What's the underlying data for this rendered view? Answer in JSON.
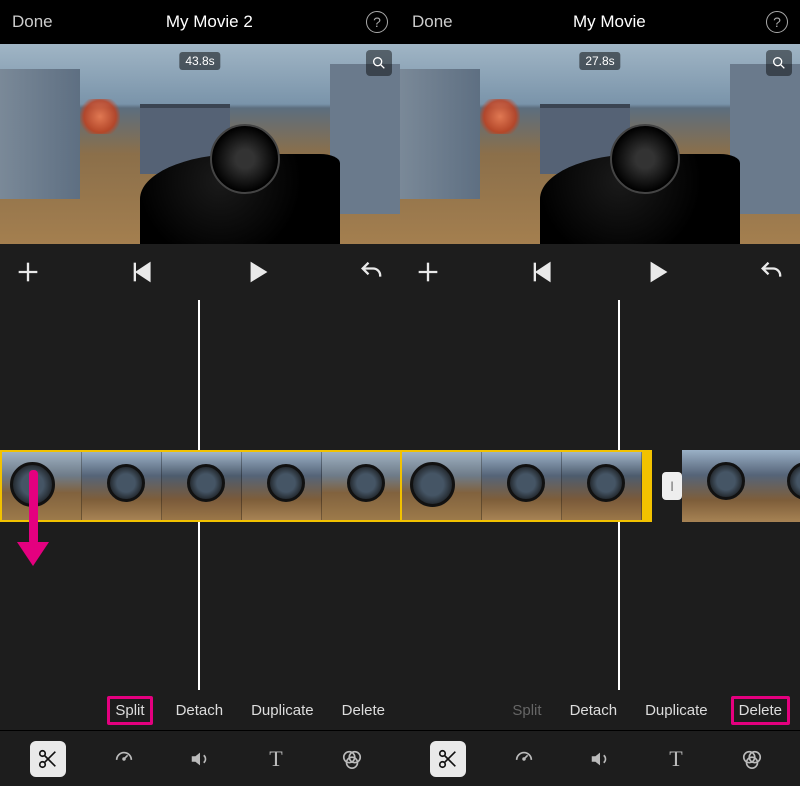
{
  "panels": [
    {
      "header": {
        "done": "Done",
        "title": "My Movie 2",
        "help": "?"
      },
      "preview": {
        "time": "43.8s"
      },
      "playheadLeft": 198,
      "clip": {
        "left": 0,
        "thumbs": 5,
        "hasHandle": false,
        "hasGap": false
      },
      "actions": [
        {
          "label": "Split",
          "boxed": true,
          "dim": false
        },
        {
          "label": "Detach",
          "boxed": false,
          "dim": false
        },
        {
          "label": "Duplicate",
          "boxed": false,
          "dim": false
        },
        {
          "label": "Delete",
          "boxed": false,
          "dim": false
        }
      ],
      "actionsAlign": "left",
      "showArrow": true,
      "toolbarActive": "scissors"
    },
    {
      "header": {
        "done": "Done",
        "title": "My Movie",
        "help": "?"
      },
      "preview": {
        "time": "27.8s"
      },
      "playheadLeft": 218,
      "clip": {
        "left": 0,
        "thumbs": 3,
        "hasHandle": true,
        "hasGap": true
      },
      "actions": [
        {
          "label": "Split",
          "boxed": false,
          "dim": true
        },
        {
          "label": "Detach",
          "boxed": false,
          "dim": false
        },
        {
          "label": "Duplicate",
          "boxed": false,
          "dim": false
        },
        {
          "label": "Delete",
          "boxed": true,
          "dim": false
        }
      ],
      "actionsAlign": "right",
      "showArrow": false,
      "toolbarActive": "scissors"
    }
  ],
  "icons": {
    "scissors": "scissors-icon",
    "speed": "speedometer-icon",
    "volume": "volume-icon",
    "text": "text-icon",
    "filters": "filters-icon"
  }
}
